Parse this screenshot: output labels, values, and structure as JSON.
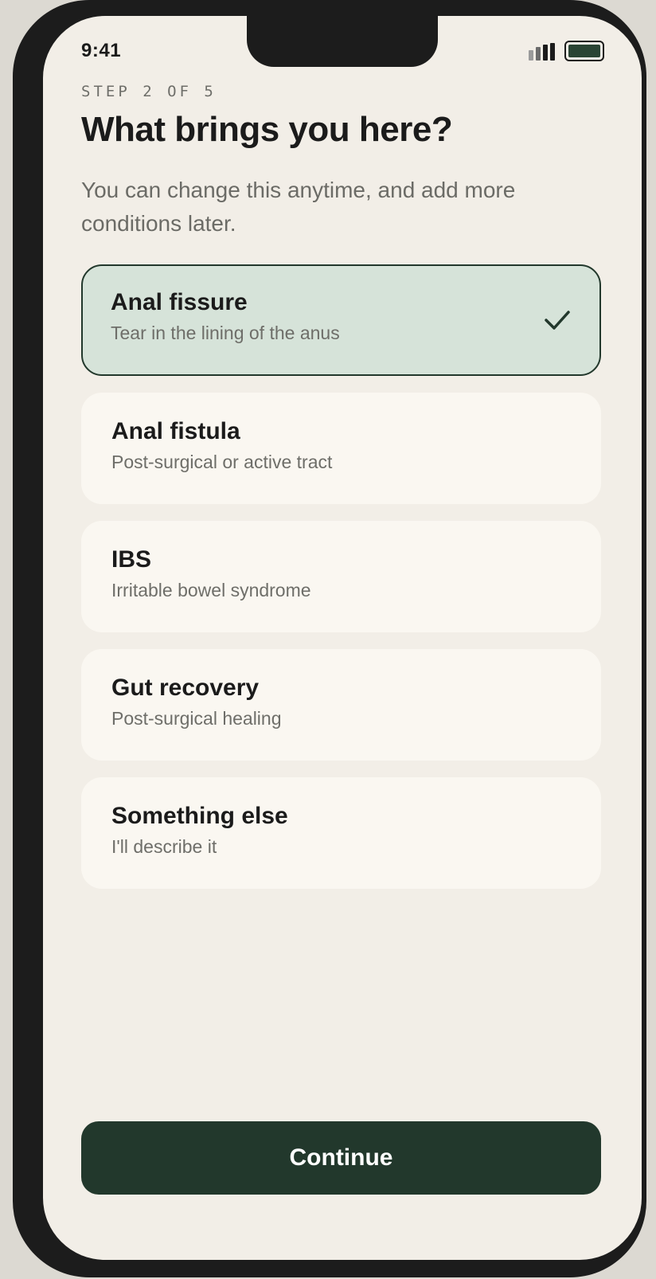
{
  "status_bar": {
    "time": "9:41",
    "signal_icon": "cellular-signal-icon",
    "battery_icon": "battery-icon"
  },
  "header": {
    "step": "STEP 2 OF 5",
    "title": "What brings you here?",
    "subtitle": "You can change this anytime, and add more conditions later."
  },
  "options": [
    {
      "title": "Anal fissure",
      "description": "Tear in the lining of the anus",
      "selected": true
    },
    {
      "title": "Anal fistula",
      "description": "Post-surgical or active tract",
      "selected": false
    },
    {
      "title": "IBS",
      "description": "Irritable bowel syndrome",
      "selected": false
    },
    {
      "title": "Gut recovery",
      "description": "Post-surgical healing",
      "selected": false
    },
    {
      "title": "Something else",
      "description": "I'll describe it",
      "selected": false
    }
  ],
  "footer": {
    "continue_label": "Continue"
  },
  "colors": {
    "accent": "#22382c",
    "selected_background": "#d6e3d9",
    "screen_background": "#f2eee7",
    "card_background": "#faf7f1"
  }
}
